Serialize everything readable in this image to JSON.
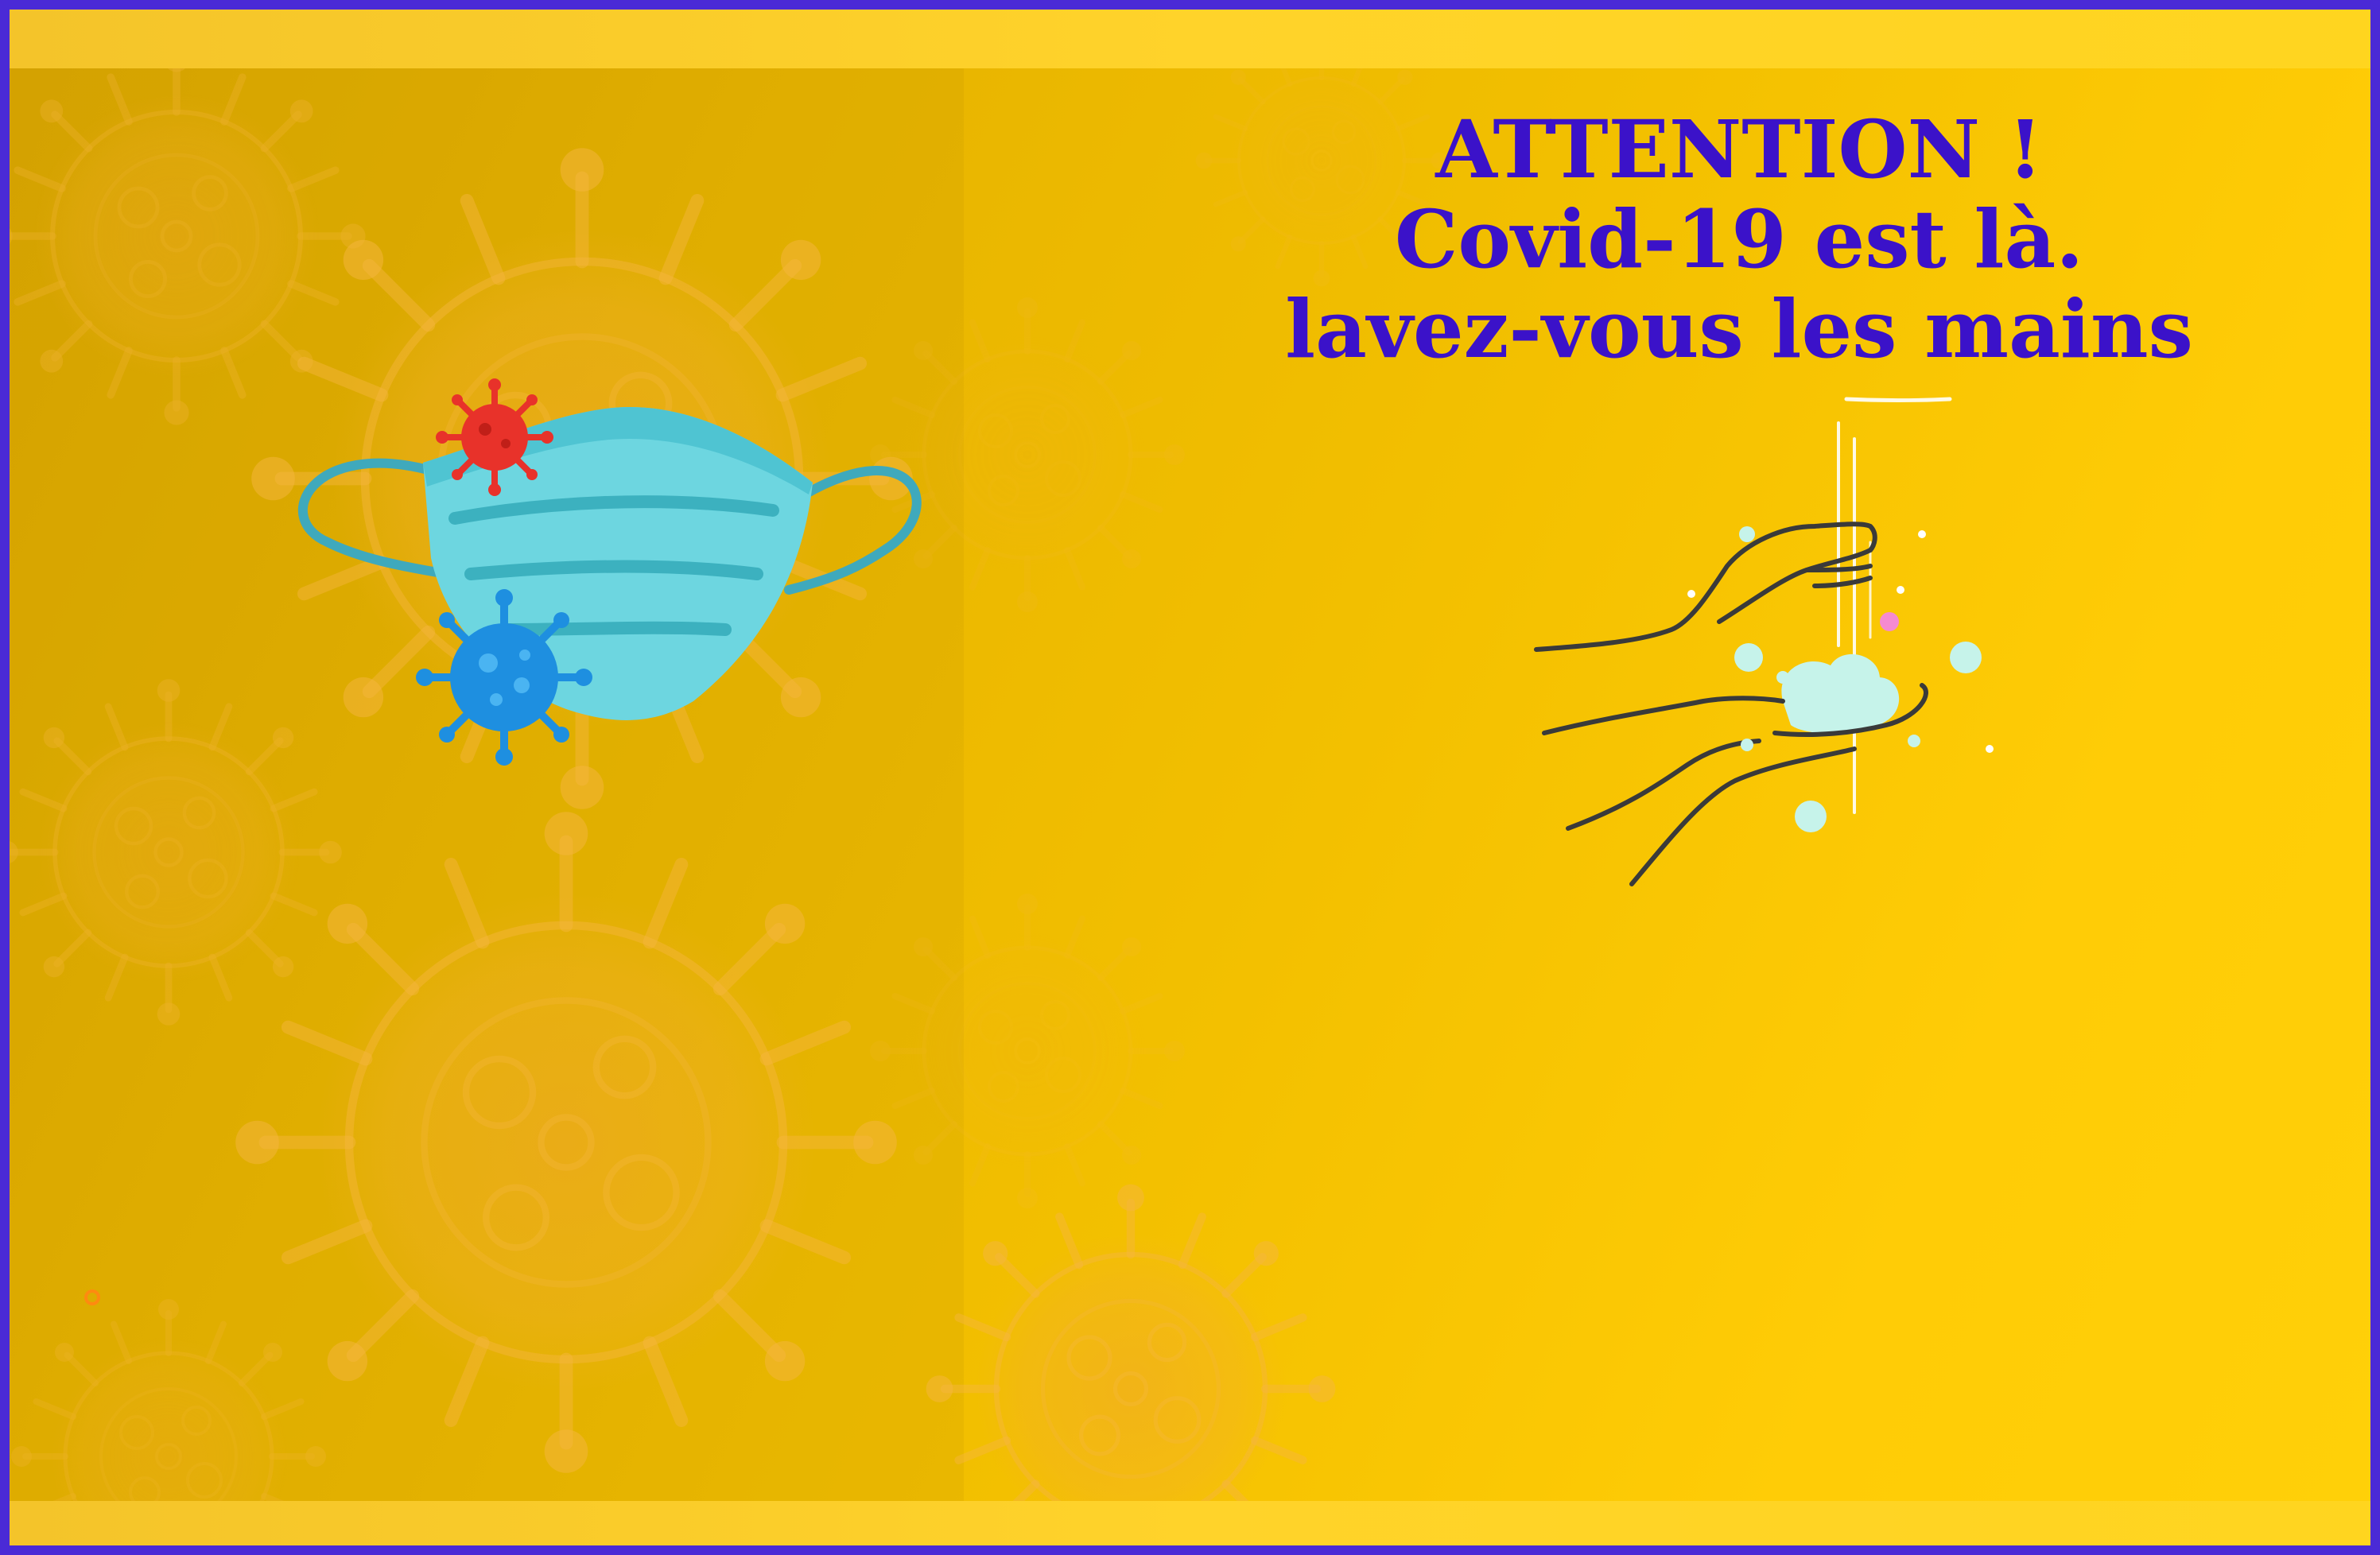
{
  "poster": {
    "headline_line1": "ATTENTION !",
    "headline_line2": "Covid-19 est là.",
    "headline_line3": "lavez-vous les mains"
  },
  "illustrations": {
    "mask": "face-mask-icon",
    "virus_red": "virus-icon",
    "virus_blue": "virus-icon",
    "hands": "hand-washing-icon"
  },
  "colors": {
    "background": "#f3c000",
    "headline": "#3b12c9",
    "border": "#4a2ad6",
    "mask": "#6dd6e0",
    "virus_red": "#e8322a",
    "virus_blue": "#1e8fe0"
  }
}
